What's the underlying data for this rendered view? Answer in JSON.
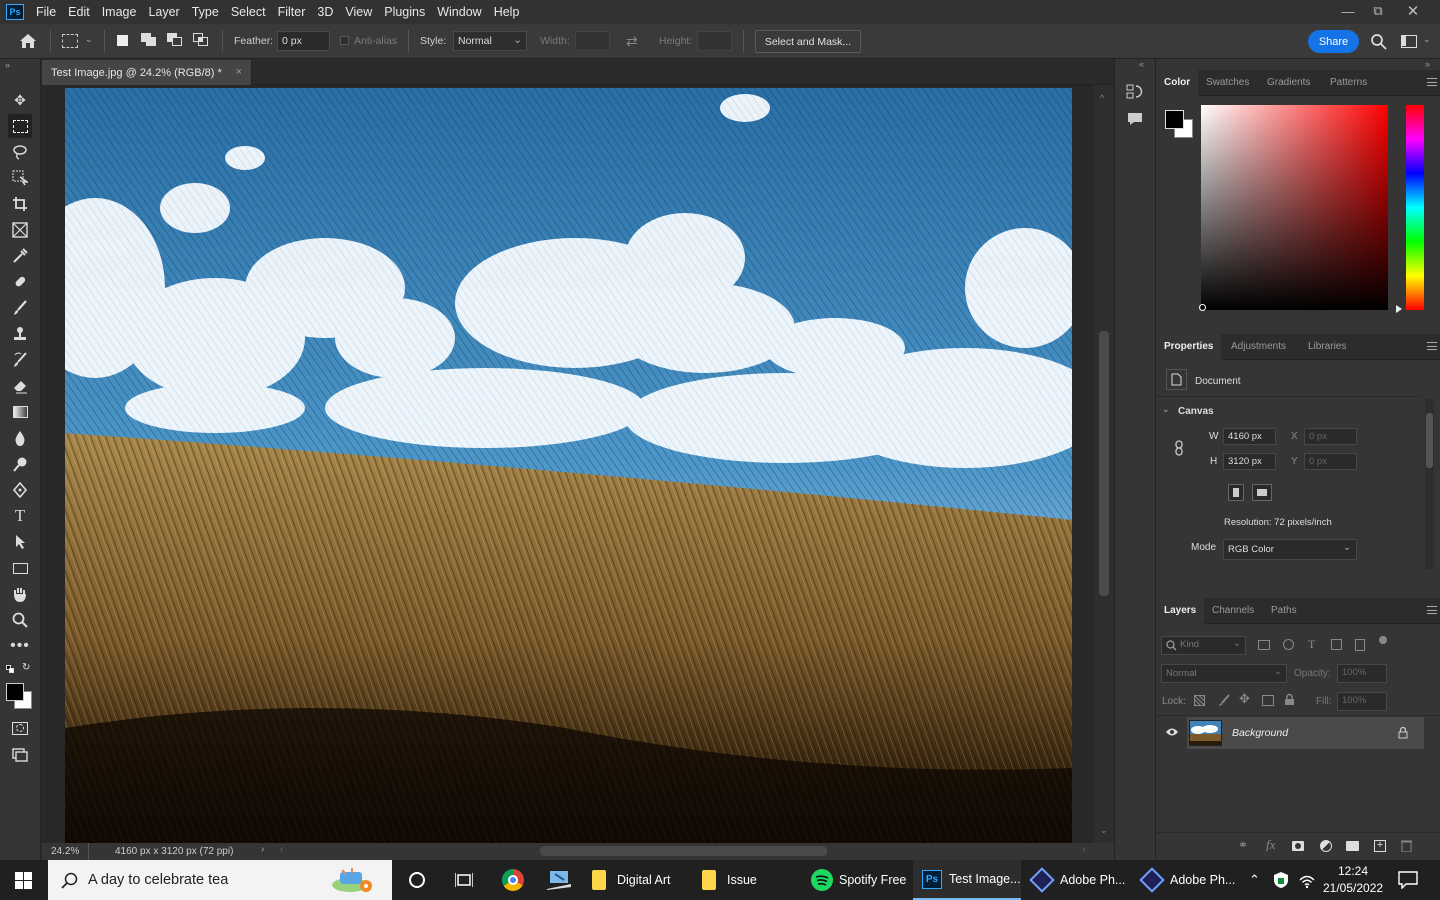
{
  "app": {
    "logo": "Ps"
  },
  "menu": [
    "File",
    "Edit",
    "Image",
    "Layer",
    "Type",
    "Select",
    "Filter",
    "3D",
    "View",
    "Plugins",
    "Window",
    "Help"
  ],
  "options": {
    "feather_label": "Feather:",
    "feather_value": "0 px",
    "antialias_label": "Anti-alias",
    "style_label": "Style:",
    "style_value": "Normal",
    "width_label": "Width:",
    "height_label": "Height:",
    "select_mask_label": "Select and Mask...",
    "share_label": "Share"
  },
  "document": {
    "tab_title": "Test Image.jpg @ 24.2% (RGB/8) *",
    "zoom": "24.2%",
    "info": "4160 px x 3120 px (72 ppi)"
  },
  "color_panel": {
    "tabs": [
      "Color",
      "Swatches",
      "Gradients",
      "Patterns"
    ],
    "foreground": "#000000",
    "background": "#ffffff",
    "hue_color": "#ff0000"
  },
  "properties_panel": {
    "tabs": [
      "Properties",
      "Adjustments",
      "Libraries"
    ],
    "doc_label": "Document",
    "section": "Canvas",
    "w_label": "W",
    "w_value": "4160 px",
    "h_label": "H",
    "h_value": "3120 px",
    "x_label": "X",
    "x_value": "0 px",
    "y_label": "Y",
    "y_value": "0 px",
    "resolution": "Resolution: 72 pixels/inch",
    "mode_label": "Mode",
    "mode_value": "RGB Color"
  },
  "layers_panel": {
    "tabs": [
      "Layers",
      "Channels",
      "Paths"
    ],
    "kind_placeholder": "Kind",
    "blend_mode": "Normal",
    "opacity_label": "Opacity:",
    "opacity_value": "100%",
    "lock_label": "Lock:",
    "fill_label": "Fill:",
    "fill_value": "100%",
    "layers": [
      {
        "name": "Background",
        "visible": true,
        "locked": true
      }
    ]
  },
  "taskbar": {
    "search_text": "A day to celebrate tea",
    "apps": [
      {
        "label": "Digital Art",
        "icon": "folder-icon"
      },
      {
        "label": "Issue",
        "icon": "folder-icon"
      },
      {
        "label": "Spotify Free",
        "icon": "spotify-icon"
      },
      {
        "label": "Test Image...",
        "icon": "photoshop-icon"
      },
      {
        "label": "Adobe Ph...",
        "icon": "adobe-icon"
      },
      {
        "label": "Adobe Ph...",
        "icon": "adobe-icon"
      }
    ],
    "time": "12:24",
    "date": "21/05/2022"
  }
}
